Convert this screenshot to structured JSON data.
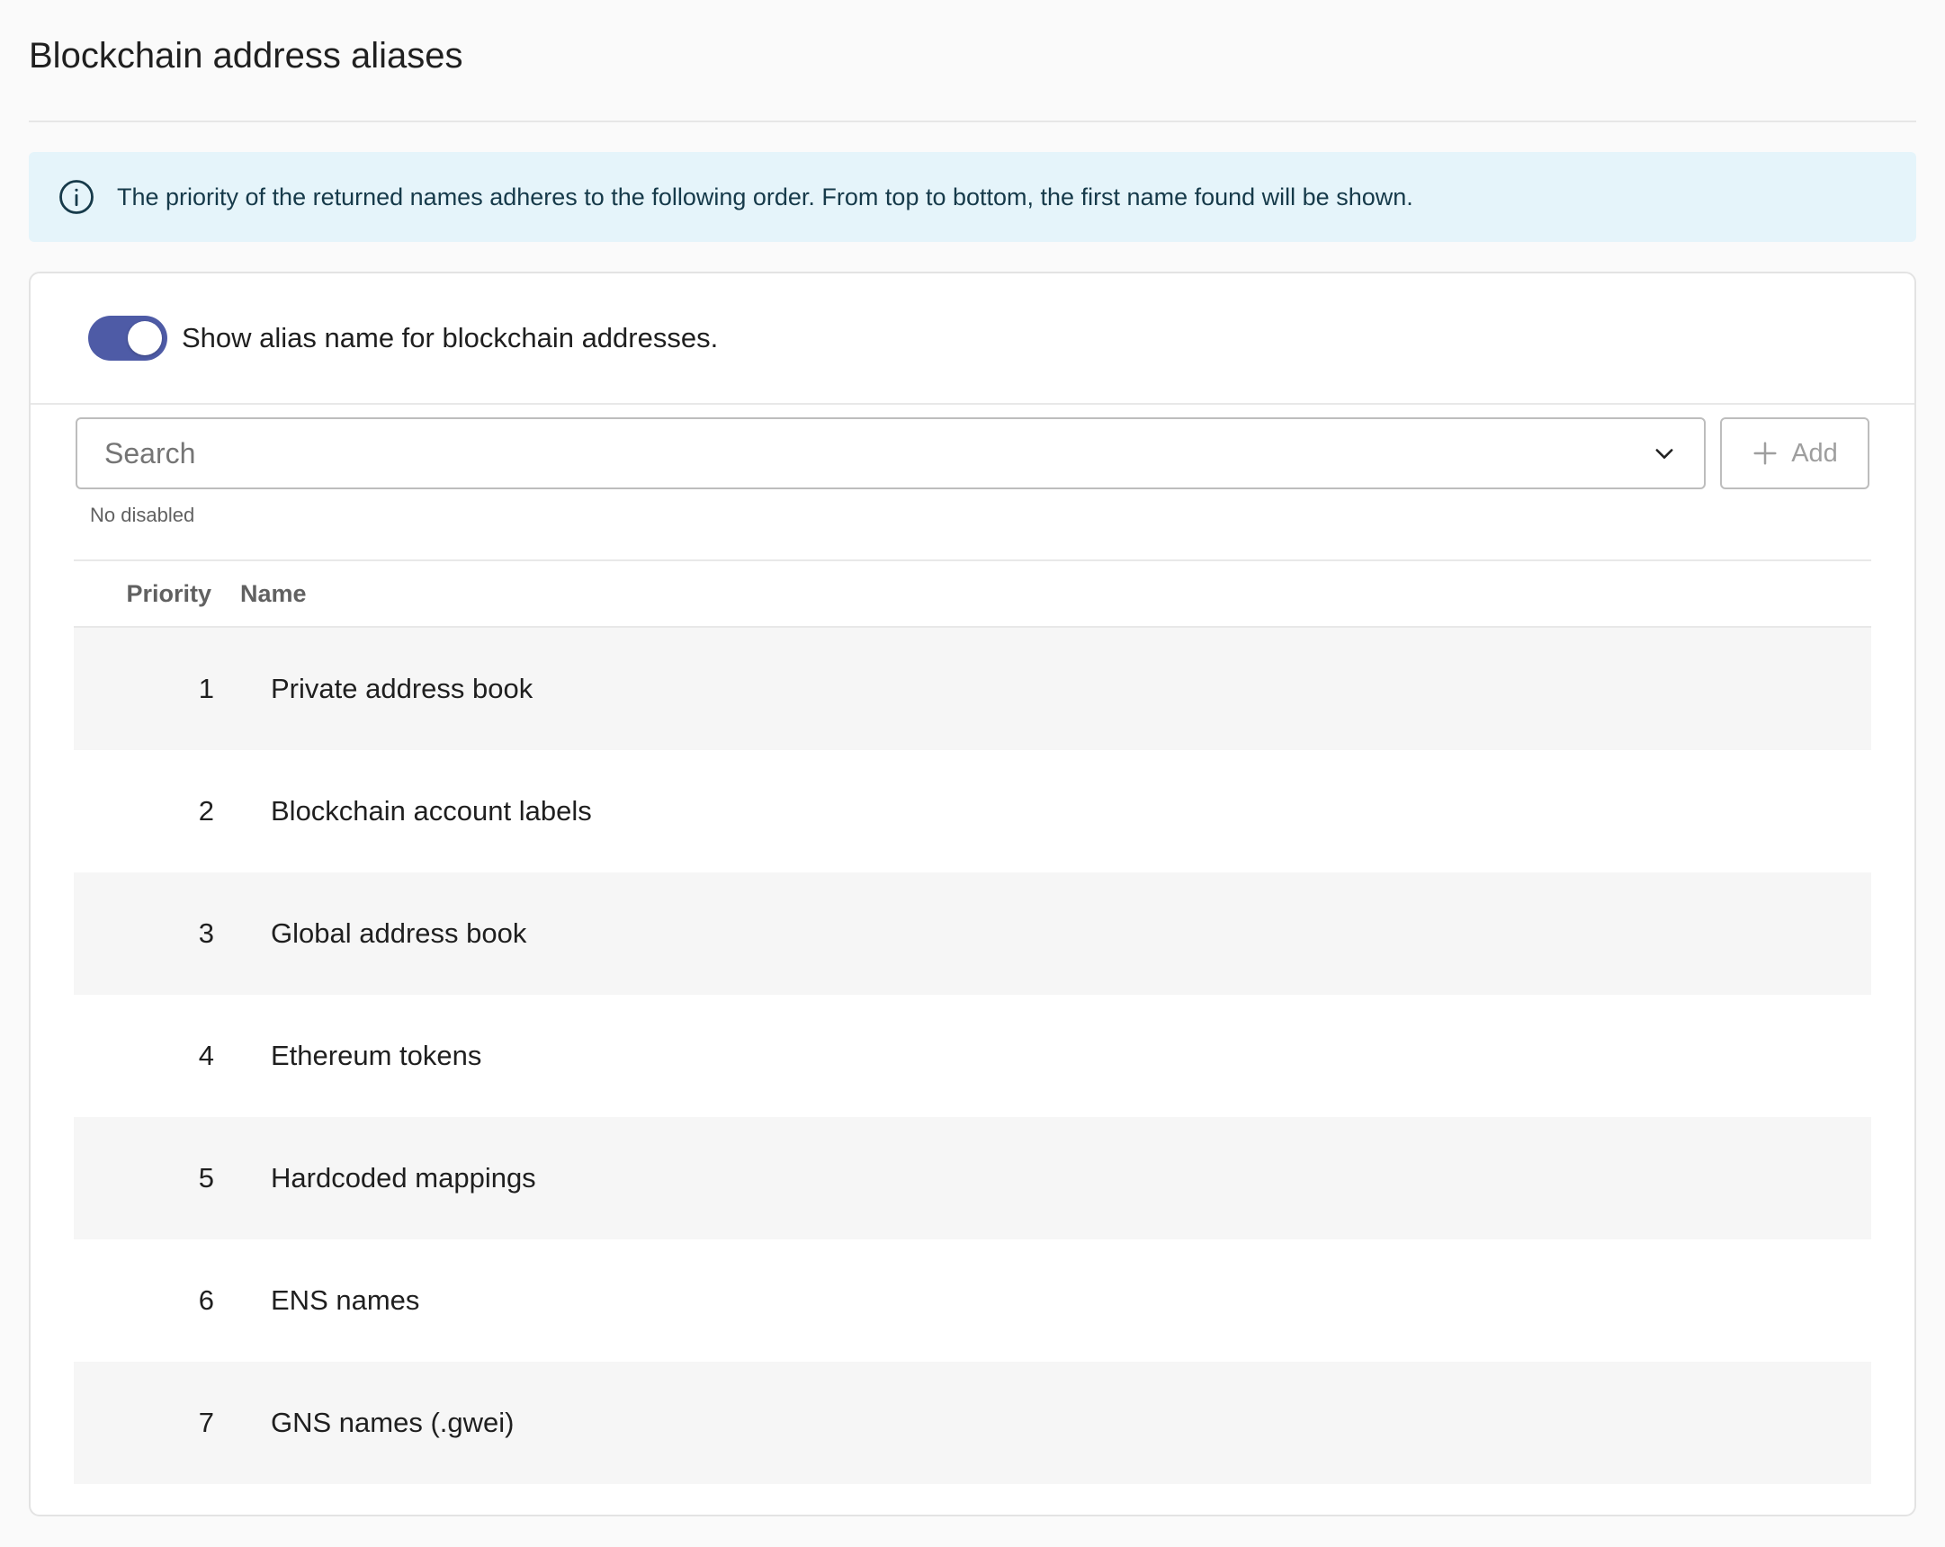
{
  "page": {
    "title": "Blockchain address aliases"
  },
  "alert": {
    "text": "The priority of the returned names adheres to the following order. From top to bottom, the first name found will be shown."
  },
  "toggle": {
    "label": "Show alias name for blockchain addresses.",
    "enabled": true
  },
  "search": {
    "placeholder": "Search",
    "hint": "No disabled"
  },
  "add_button": {
    "label": "Add"
  },
  "table": {
    "headers": {
      "priority": "Priority",
      "name": "Name"
    },
    "rows": [
      {
        "priority": "1",
        "name": "Private address book"
      },
      {
        "priority": "2",
        "name": "Blockchain account labels"
      },
      {
        "priority": "3",
        "name": "Global address book"
      },
      {
        "priority": "4",
        "name": "Ethereum tokens"
      },
      {
        "priority": "5",
        "name": "Hardcoded mappings"
      },
      {
        "priority": "6",
        "name": "ENS names"
      },
      {
        "priority": "7",
        "name": "GNS names (.gwei)"
      }
    ]
  },
  "colors": {
    "accent": "#4e5ba6",
    "alert_bg": "#e5f4fa",
    "alert_text": "#163a4a"
  }
}
